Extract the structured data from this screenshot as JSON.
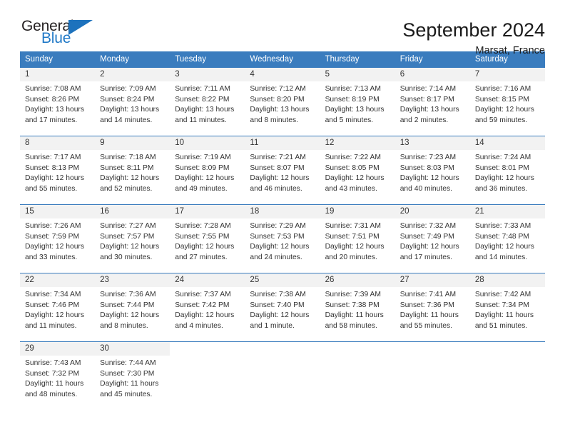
{
  "logo": {
    "word_top": "General",
    "word_bottom": "Blue",
    "triangle_color": "#1d72bd",
    "text_color": "#231f20",
    "blue_color": "#2079c7"
  },
  "header": {
    "title": "September 2024",
    "subtitle": "Marsat, France"
  },
  "theme": {
    "header_blue": "#3a7cbe",
    "daynum_bg": "#f2f2f2",
    "text": "#333333"
  },
  "weekday_headers": [
    "Sunday",
    "Monday",
    "Tuesday",
    "Wednesday",
    "Thursday",
    "Friday",
    "Saturday"
  ],
  "weeks": [
    [
      {
        "day": "1",
        "sunrise": "Sunrise: 7:08 AM",
        "sunset": "Sunset: 8:26 PM",
        "daylight1": "Daylight: 13 hours",
        "daylight2": "and 17 minutes."
      },
      {
        "day": "2",
        "sunrise": "Sunrise: 7:09 AM",
        "sunset": "Sunset: 8:24 PM",
        "daylight1": "Daylight: 13 hours",
        "daylight2": "and 14 minutes."
      },
      {
        "day": "3",
        "sunrise": "Sunrise: 7:11 AM",
        "sunset": "Sunset: 8:22 PM",
        "daylight1": "Daylight: 13 hours",
        "daylight2": "and 11 minutes."
      },
      {
        "day": "4",
        "sunrise": "Sunrise: 7:12 AM",
        "sunset": "Sunset: 8:20 PM",
        "daylight1": "Daylight: 13 hours",
        "daylight2": "and 8 minutes."
      },
      {
        "day": "5",
        "sunrise": "Sunrise: 7:13 AM",
        "sunset": "Sunset: 8:19 PM",
        "daylight1": "Daylight: 13 hours",
        "daylight2": "and 5 minutes."
      },
      {
        "day": "6",
        "sunrise": "Sunrise: 7:14 AM",
        "sunset": "Sunset: 8:17 PM",
        "daylight1": "Daylight: 13 hours",
        "daylight2": "and 2 minutes."
      },
      {
        "day": "7",
        "sunrise": "Sunrise: 7:16 AM",
        "sunset": "Sunset: 8:15 PM",
        "daylight1": "Daylight: 12 hours",
        "daylight2": "and 59 minutes."
      }
    ],
    [
      {
        "day": "8",
        "sunrise": "Sunrise: 7:17 AM",
        "sunset": "Sunset: 8:13 PM",
        "daylight1": "Daylight: 12 hours",
        "daylight2": "and 55 minutes."
      },
      {
        "day": "9",
        "sunrise": "Sunrise: 7:18 AM",
        "sunset": "Sunset: 8:11 PM",
        "daylight1": "Daylight: 12 hours",
        "daylight2": "and 52 minutes."
      },
      {
        "day": "10",
        "sunrise": "Sunrise: 7:19 AM",
        "sunset": "Sunset: 8:09 PM",
        "daylight1": "Daylight: 12 hours",
        "daylight2": "and 49 minutes."
      },
      {
        "day": "11",
        "sunrise": "Sunrise: 7:21 AM",
        "sunset": "Sunset: 8:07 PM",
        "daylight1": "Daylight: 12 hours",
        "daylight2": "and 46 minutes."
      },
      {
        "day": "12",
        "sunrise": "Sunrise: 7:22 AM",
        "sunset": "Sunset: 8:05 PM",
        "daylight1": "Daylight: 12 hours",
        "daylight2": "and 43 minutes."
      },
      {
        "day": "13",
        "sunrise": "Sunrise: 7:23 AM",
        "sunset": "Sunset: 8:03 PM",
        "daylight1": "Daylight: 12 hours",
        "daylight2": "and 40 minutes."
      },
      {
        "day": "14",
        "sunrise": "Sunrise: 7:24 AM",
        "sunset": "Sunset: 8:01 PM",
        "daylight1": "Daylight: 12 hours",
        "daylight2": "and 36 minutes."
      }
    ],
    [
      {
        "day": "15",
        "sunrise": "Sunrise: 7:26 AM",
        "sunset": "Sunset: 7:59 PM",
        "daylight1": "Daylight: 12 hours",
        "daylight2": "and 33 minutes."
      },
      {
        "day": "16",
        "sunrise": "Sunrise: 7:27 AM",
        "sunset": "Sunset: 7:57 PM",
        "daylight1": "Daylight: 12 hours",
        "daylight2": "and 30 minutes."
      },
      {
        "day": "17",
        "sunrise": "Sunrise: 7:28 AM",
        "sunset": "Sunset: 7:55 PM",
        "daylight1": "Daylight: 12 hours",
        "daylight2": "and 27 minutes."
      },
      {
        "day": "18",
        "sunrise": "Sunrise: 7:29 AM",
        "sunset": "Sunset: 7:53 PM",
        "daylight1": "Daylight: 12 hours",
        "daylight2": "and 24 minutes."
      },
      {
        "day": "19",
        "sunrise": "Sunrise: 7:31 AM",
        "sunset": "Sunset: 7:51 PM",
        "daylight1": "Daylight: 12 hours",
        "daylight2": "and 20 minutes."
      },
      {
        "day": "20",
        "sunrise": "Sunrise: 7:32 AM",
        "sunset": "Sunset: 7:49 PM",
        "daylight1": "Daylight: 12 hours",
        "daylight2": "and 17 minutes."
      },
      {
        "day": "21",
        "sunrise": "Sunrise: 7:33 AM",
        "sunset": "Sunset: 7:48 PM",
        "daylight1": "Daylight: 12 hours",
        "daylight2": "and 14 minutes."
      }
    ],
    [
      {
        "day": "22",
        "sunrise": "Sunrise: 7:34 AM",
        "sunset": "Sunset: 7:46 PM",
        "daylight1": "Daylight: 12 hours",
        "daylight2": "and 11 minutes."
      },
      {
        "day": "23",
        "sunrise": "Sunrise: 7:36 AM",
        "sunset": "Sunset: 7:44 PM",
        "daylight1": "Daylight: 12 hours",
        "daylight2": "and 8 minutes."
      },
      {
        "day": "24",
        "sunrise": "Sunrise: 7:37 AM",
        "sunset": "Sunset: 7:42 PM",
        "daylight1": "Daylight: 12 hours",
        "daylight2": "and 4 minutes."
      },
      {
        "day": "25",
        "sunrise": "Sunrise: 7:38 AM",
        "sunset": "Sunset: 7:40 PM",
        "daylight1": "Daylight: 12 hours",
        "daylight2": "and 1 minute."
      },
      {
        "day": "26",
        "sunrise": "Sunrise: 7:39 AM",
        "sunset": "Sunset: 7:38 PM",
        "daylight1": "Daylight: 11 hours",
        "daylight2": "and 58 minutes."
      },
      {
        "day": "27",
        "sunrise": "Sunrise: 7:41 AM",
        "sunset": "Sunset: 7:36 PM",
        "daylight1": "Daylight: 11 hours",
        "daylight2": "and 55 minutes."
      },
      {
        "day": "28",
        "sunrise": "Sunrise: 7:42 AM",
        "sunset": "Sunset: 7:34 PM",
        "daylight1": "Daylight: 11 hours",
        "daylight2": "and 51 minutes."
      }
    ],
    [
      {
        "day": "29",
        "sunrise": "Sunrise: 7:43 AM",
        "sunset": "Sunset: 7:32 PM",
        "daylight1": "Daylight: 11 hours",
        "daylight2": "and 48 minutes."
      },
      {
        "day": "30",
        "sunrise": "Sunrise: 7:44 AM",
        "sunset": "Sunset: 7:30 PM",
        "daylight1": "Daylight: 11 hours",
        "daylight2": "and 45 minutes."
      },
      {
        "day": "",
        "sunrise": "",
        "sunset": "",
        "daylight1": "",
        "daylight2": ""
      },
      {
        "day": "",
        "sunrise": "",
        "sunset": "",
        "daylight1": "",
        "daylight2": ""
      },
      {
        "day": "",
        "sunrise": "",
        "sunset": "",
        "daylight1": "",
        "daylight2": ""
      },
      {
        "day": "",
        "sunrise": "",
        "sunset": "",
        "daylight1": "",
        "daylight2": ""
      },
      {
        "day": "",
        "sunrise": "",
        "sunset": "",
        "daylight1": "",
        "daylight2": ""
      }
    ]
  ]
}
